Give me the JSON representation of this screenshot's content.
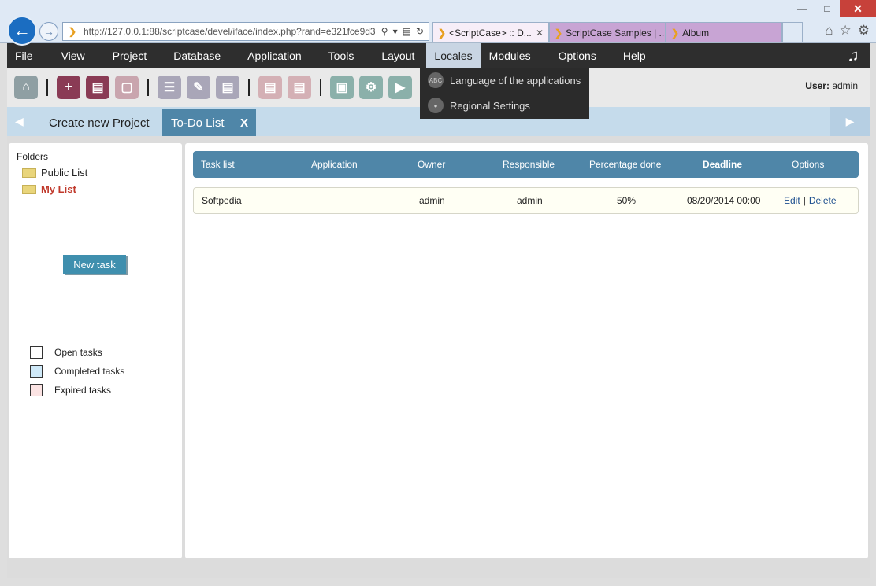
{
  "browser": {
    "url": "http://127.0.0.1:88/scriptcase/devel/iface/index.php?rand=e321fce9d3",
    "tabs": [
      {
        "label": "<ScriptCase> :: D..."
      },
      {
        "label": "ScriptCase Samples | ..."
      },
      {
        "label": "Album"
      }
    ]
  },
  "menu": {
    "items": [
      "File",
      "View",
      "Project",
      "Database",
      "Application",
      "Tools",
      "Layout",
      "Locales",
      "Modules",
      "Options",
      "Help"
    ],
    "open_item": "Locales"
  },
  "dropdown": {
    "items": [
      "Language of the applications",
      "Regional Settings"
    ]
  },
  "toolbar": {
    "user_label": "User:",
    "user_name": "admin"
  },
  "app_tabs": {
    "create": "Create new Project",
    "todo": "To-Do List",
    "close": "X"
  },
  "sidebar": {
    "folders_title": "Folders",
    "folders": [
      "Public List",
      "My List"
    ],
    "new_task": "New task",
    "legend": [
      "Open tasks",
      "Completed tasks",
      "Expired tasks"
    ]
  },
  "table": {
    "headers": [
      "Task list",
      "Application",
      "Owner",
      "Responsible",
      "Percentage done",
      "Deadline",
      "Options"
    ],
    "rows": [
      {
        "task": "Softpedia",
        "application": "",
        "owner": "admin",
        "responsible": "admin",
        "percent": "50%",
        "deadline": "08/20/2014 00:00",
        "edit": "Edit",
        "sep": "|",
        "delete": "Delete"
      }
    ]
  },
  "colors": {
    "menu_bg": "#2e2e2e",
    "accent": "#4f86a8",
    "my_list": "#c0392b",
    "completed": "#cfe9f8",
    "expired": "#fbe3e3"
  }
}
